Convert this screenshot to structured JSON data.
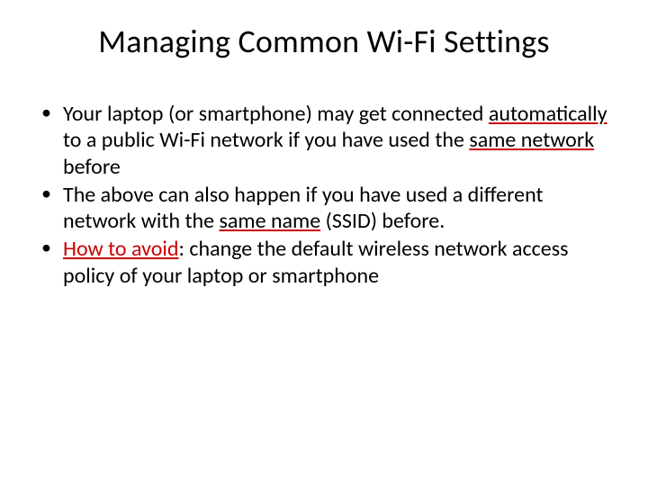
{
  "slide": {
    "title": "Managing Common Wi-Fi Settings",
    "bullets": [
      {
        "seg1": "Your laptop (or smartphone) may get connected ",
        "seg2_ul": "automatically",
        "seg3": " to a public Wi-Fi network if you have used the ",
        "seg4_ul": "same network",
        "seg5": " before"
      },
      {
        "seg1": " The above can also happen if you have used a different network with the ",
        "seg2_ul": "same name",
        "seg3": " (SSID) before."
      },
      {
        "seg1_red_ul": "How to avoid",
        "seg2": ": change the default wireless network access policy of your laptop or smartphone"
      }
    ]
  }
}
